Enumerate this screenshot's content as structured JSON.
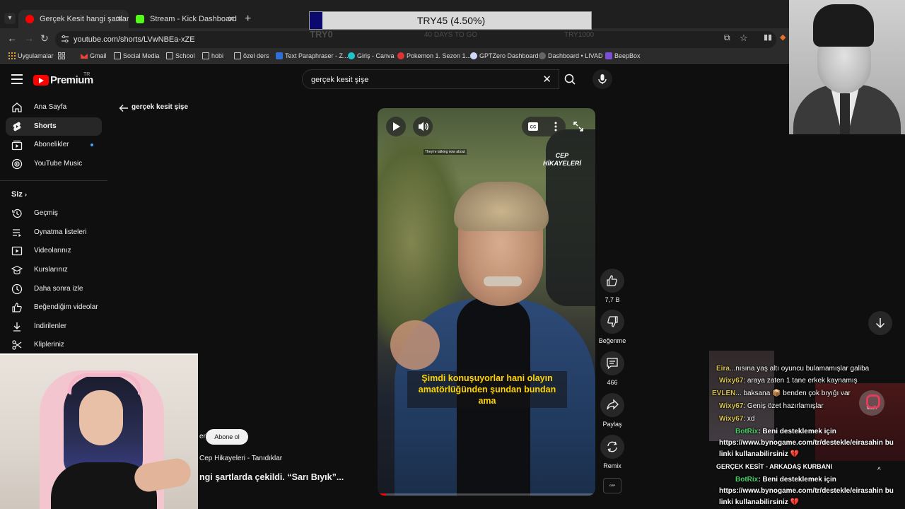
{
  "browser": {
    "tabs": [
      {
        "title": "Gerçek Kesit hangi şartlarda...",
        "active": true
      },
      {
        "title": "Stream - Kick Dashboard",
        "active": false
      }
    ],
    "url": "youtube.com/shorts/LVwNBEa-xZE",
    "bookmarks": [
      {
        "label": "Uygulamalar",
        "icon": "apps-grid-icon"
      },
      {
        "label": "Gmail",
        "icon": "gmail-icon"
      },
      {
        "label": "Social Media",
        "icon": "folder-icon"
      },
      {
        "label": "School",
        "icon": "folder-icon"
      },
      {
        "label": "hobi",
        "icon": "folder-icon"
      },
      {
        "label": "özel ders",
        "icon": "folder-icon"
      },
      {
        "label": "Text Paraphraser - Z...",
        "icon": "site-icon"
      },
      {
        "label": "Giriş - Canva",
        "icon": "canva-icon"
      },
      {
        "label": "Pokemon 1. Sezon 1...",
        "icon": "site-icon"
      },
      {
        "label": "GPTZero Dashboard",
        "icon": "site-icon"
      },
      {
        "label": "Dashboard • LIVAD",
        "icon": "site-icon"
      },
      {
        "label": "BeepBox",
        "icon": "site-icon"
      }
    ]
  },
  "youtube": {
    "logo_text": "Premium",
    "logo_badge": "TR",
    "search_query": "gerçek kesit şişe",
    "sidebar": {
      "main": [
        {
          "label": "Ana Sayfa",
          "icon": "home-icon"
        },
        {
          "label": "Shorts",
          "icon": "shorts-icon",
          "active": true
        },
        {
          "label": "Abonelikler",
          "icon": "subscriptions-icon",
          "dot": true
        },
        {
          "label": "YouTube Music",
          "icon": "music-icon"
        }
      ],
      "you_header": "Siz",
      "you": [
        {
          "label": "Geçmiş",
          "icon": "history-icon"
        },
        {
          "label": "Oynatma listeleri",
          "icon": "playlist-icon"
        },
        {
          "label": "Videolarınız",
          "icon": "your-videos-icon"
        },
        {
          "label": "Kurslarınız",
          "icon": "courses-icon"
        },
        {
          "label": "Daha sonra izle",
          "icon": "clock-icon"
        },
        {
          "label": "Beğendiğim videolar",
          "icon": "thumbs-up-icon"
        },
        {
          "label": "İndirilenler",
          "icon": "download-icon"
        },
        {
          "label": "Klipleriniz",
          "icon": "scissors-icon"
        }
      ]
    },
    "back_label": "gerçek kesit şişe",
    "video": {
      "watermark": "CEP\nHİKAYELERİ",
      "overlay_small": "They're talking now about",
      "subtitle": "Şimdi konuşuyorlar hani olayın amatörlüğünden şundan bundan ama",
      "progress": 0.04
    },
    "actions": {
      "like_count": "7,7 B",
      "dislike_label": "Beğenme",
      "comments_count": "466",
      "share_label": "Paylaş",
      "remix_label": "Remix"
    },
    "channel_tail": "eri",
    "subscribe_label": "Abone ol",
    "channel_full": "Cep Hikayeleri - Tanıdıklar",
    "title_visible": "ngi şartlarda çekildi. “Sarı Bıyık”..."
  },
  "stream": {
    "goal_text": "TRY45 (4.50%)",
    "goal_progress": 0.045,
    "goal_left": "TRY0",
    "goal_mid": "40 DAYS TO GO",
    "goal_right": "TRY1000",
    "chat": [
      {
        "nick": "Eira",
        "text": "...nısına yaş altı oyuncu bulamamışlar galiba",
        "nick_class": "nick-y"
      },
      {
        "nick": "Wixy67",
        "text": ": araya zaten 1 tane erkek kaynamış",
        "nick_class": "nick-y"
      },
      {
        "nick": "EVLEN",
        "text": "... baksana 📦 benden çok bıyığı var",
        "nick_class": "nick-y"
      },
      {
        "nick": "Wixy67",
        "text": ": Geniş özet hazırlamışlar",
        "nick_class": "nick-y"
      },
      {
        "nick": "Wixy67",
        "text": ": xd",
        "nick_class": "nick-y"
      },
      {
        "nick": "BotRix",
        "text": ": Beni desteklemek için",
        "nick_class": "nick-g"
      },
      {
        "nick": "",
        "text": "https://www.bynogame.com/tr/destekle/eirasahin bu",
        "nick_class": ""
      },
      {
        "nick": "",
        "text": "linki kullanabilirsiniz 💔",
        "nick_class": ""
      },
      {
        "nick": "",
        "text": "GERÇEK KESİT - ARKADAŞ KURBANI",
        "nick_class": ""
      },
      {
        "nick": "BotRix",
        "text": ": Beni desteklemek için",
        "nick_class": "nick-g"
      },
      {
        "nick": "",
        "text": "https://www.bynogame.com/tr/destekle/eirasahin bu",
        "nick_class": ""
      },
      {
        "nick": "",
        "text": "linki kullanabilirsiniz 💔",
        "nick_class": ""
      }
    ],
    "flash_label": "flash"
  },
  "colors": {
    "yt_red": "#ff0000",
    "bg": "#0f0f0f",
    "goal_fill": "#0a0a6e",
    "subtitle_yellow": "#ffd400"
  }
}
